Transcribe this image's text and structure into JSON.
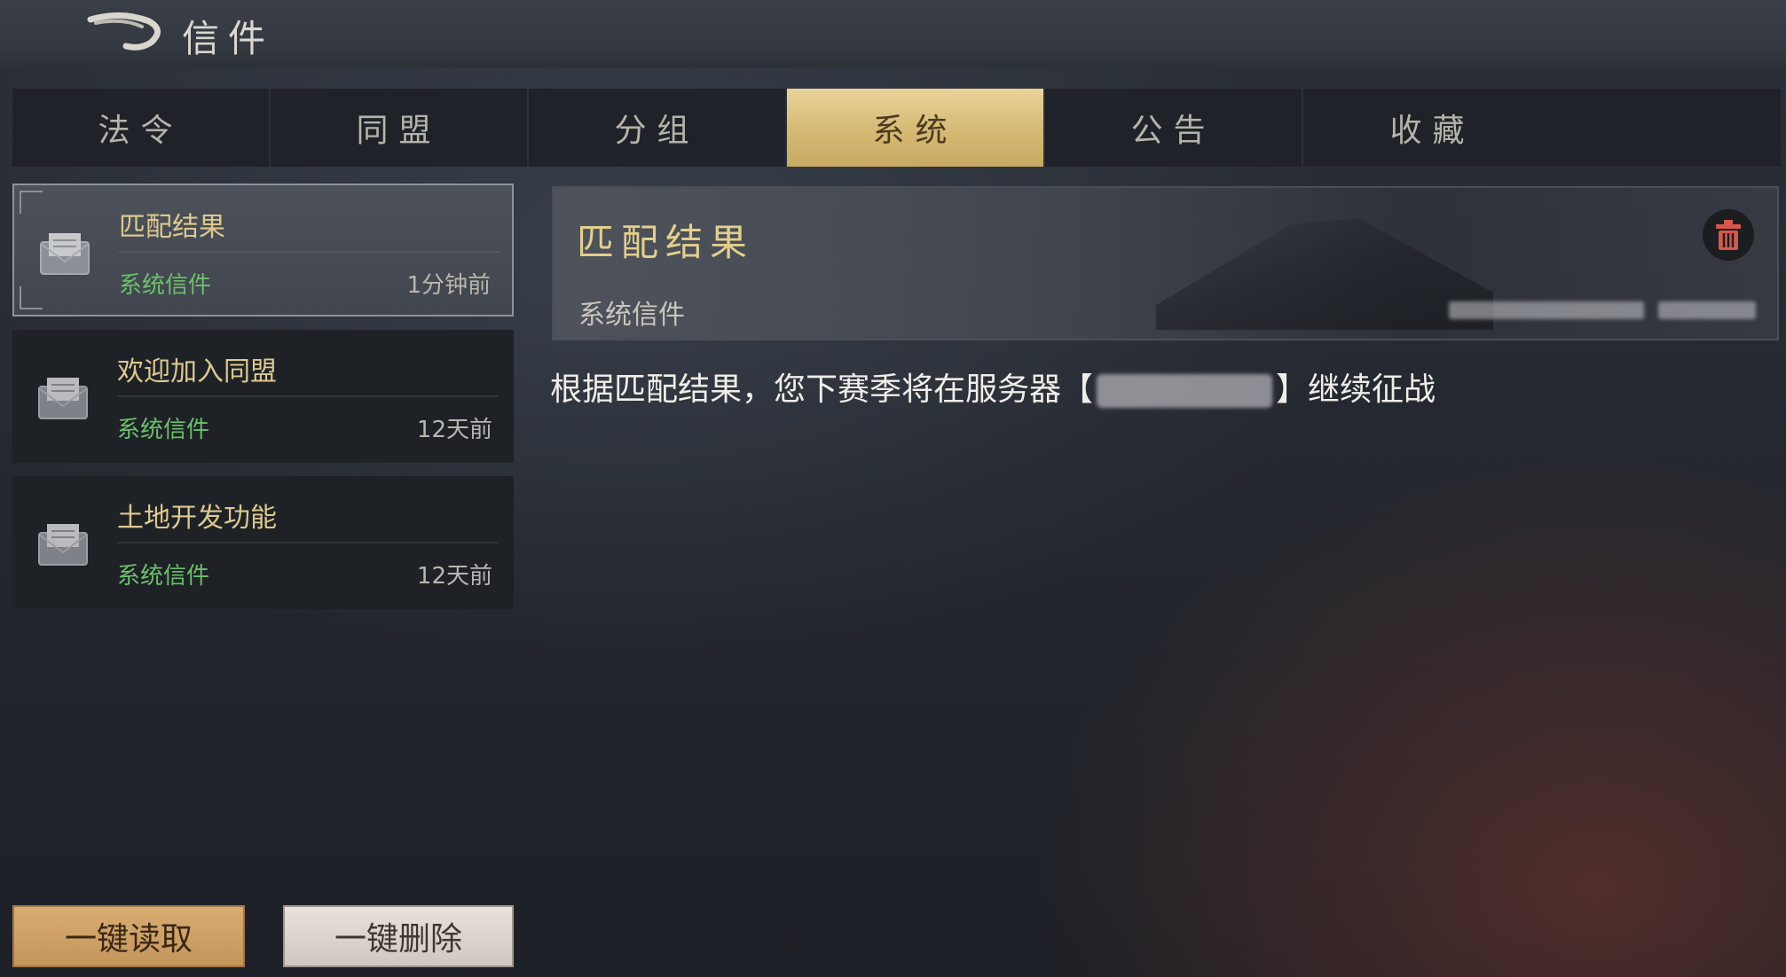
{
  "header": {
    "title": "信件",
    "back_icon": "back-arrow-icon"
  },
  "tabs": [
    {
      "label": "法令",
      "active": false
    },
    {
      "label": "同盟",
      "active": false
    },
    {
      "label": "分组",
      "active": false
    },
    {
      "label": "系统",
      "active": true
    },
    {
      "label": "公告",
      "active": false
    },
    {
      "label": "收藏",
      "active": false
    }
  ],
  "mail_list": [
    {
      "title": "匹配结果",
      "type": "系统信件",
      "time": "1分钟前",
      "selected": true,
      "icon": "envelope-icon"
    },
    {
      "title": "欢迎加入同盟",
      "type": "系统信件",
      "time": "12天前",
      "selected": false,
      "icon": "envelope-icon"
    },
    {
      "title": "土地开发功能",
      "type": "系统信件",
      "time": "12天前",
      "selected": false,
      "icon": "envelope-icon"
    }
  ],
  "detail": {
    "title": "匹配结果",
    "sender": "系统信件",
    "body_prefix": "根据匹配结果，您下赛季将在服务器【",
    "body_suffix": "】继续征战",
    "delete_icon": "trash-icon"
  },
  "buttons": {
    "read_all": "一键读取",
    "delete_all": "一键删除"
  },
  "colors": {
    "gold_title": "#ddc98f",
    "green_type": "#6cc06a",
    "active_tab": "#d5b974",
    "delete_red": "#d9574a"
  }
}
